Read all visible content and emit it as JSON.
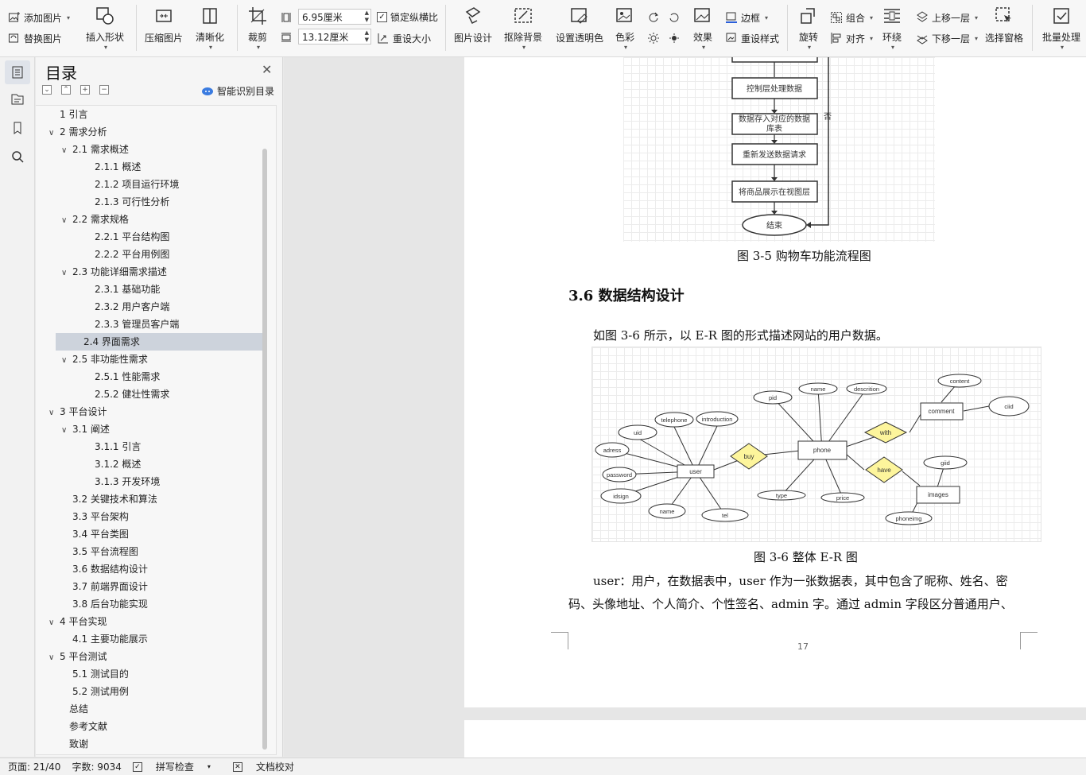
{
  "ribbon": {
    "add_picture": "添加图片",
    "replace_picture": "替换图片",
    "insert_shape": "插入形状",
    "compress": "压缩图片",
    "sharpen": "清晰化",
    "crop": "裁剪",
    "width_value": "6.95厘米",
    "height_value": "13.12厘米",
    "lock_ratio": "锁定纵横比",
    "reset_size": "重设大小",
    "picture_design": "图片设计",
    "remove_bg": "抠除背景",
    "set_transparent": "设置透明色",
    "color": "色彩",
    "effects": "效果",
    "border": "边框",
    "reset_style": "重设样式",
    "rotate": "旋转",
    "group": "组合",
    "align": "对齐",
    "wrap": "环绕",
    "bring_forward": "上移一层",
    "send_backward": "下移一层",
    "selection_pane": "选择窗格",
    "batch": "批量处理"
  },
  "toc": {
    "title": "目录",
    "smart_label": "智能识别目录",
    "items": [
      {
        "label": "1  引言",
        "level": 1,
        "arrow": ""
      },
      {
        "label": "2  需求分析",
        "level": 1,
        "arrow": "∨"
      },
      {
        "label": "2.1  需求概述",
        "level": 2,
        "arrow": "∨"
      },
      {
        "label": "2.1.1  概述",
        "level": 3,
        "arrow": ""
      },
      {
        "label": "2.1.2  项目运行环境",
        "level": 3,
        "arrow": ""
      },
      {
        "label": "2.1.3  可行性分析",
        "level": 3,
        "arrow": ""
      },
      {
        "label": "2.2  需求规格",
        "level": 2,
        "arrow": "∨"
      },
      {
        "label": "2.2.1  平台结构图",
        "level": 3,
        "arrow": ""
      },
      {
        "label": "2.2.2  平台用例图",
        "level": 3,
        "arrow": ""
      },
      {
        "label": "2.3  功能详细需求描述",
        "level": 2,
        "arrow": "∨"
      },
      {
        "label": "2.3.1  基础功能",
        "level": 3,
        "arrow": ""
      },
      {
        "label": "2.3.2  用户客户端",
        "level": 3,
        "arrow": ""
      },
      {
        "label": "2.3.3  管理员客户端",
        "level": 3,
        "arrow": ""
      },
      {
        "label": "2.4  界面需求",
        "level": 2,
        "arrow": "",
        "selected": true
      },
      {
        "label": "2.5 非功能性需求",
        "level": 2,
        "arrow": "∨"
      },
      {
        "label": "2.5.1  性能需求",
        "level": 3,
        "arrow": ""
      },
      {
        "label": "2.5.2  健壮性需求",
        "level": 3,
        "arrow": ""
      },
      {
        "label": "3  平台设计",
        "level": 1,
        "arrow": "∨"
      },
      {
        "label": "3.1  阐述",
        "level": 2,
        "arrow": "∨"
      },
      {
        "label": "3.1.1  引言",
        "level": 3,
        "arrow": ""
      },
      {
        "label": "3.1.2  概述",
        "level": 3,
        "arrow": ""
      },
      {
        "label": "3.1.3  开发环境",
        "level": 3,
        "arrow": ""
      },
      {
        "label": "3.2  关键技术和算法",
        "level": 2,
        "arrow": ""
      },
      {
        "label": "3.3  平台架构",
        "level": 2,
        "arrow": ""
      },
      {
        "label": "3.4  平台类图",
        "level": 2,
        "arrow": ""
      },
      {
        "label": "3.5  平台流程图",
        "level": 2,
        "arrow": ""
      },
      {
        "label": "3.6  数据结构设计",
        "level": 2,
        "arrow": ""
      },
      {
        "label": "3.7  前端界面设计",
        "level": 2,
        "arrow": ""
      },
      {
        "label": "3.8  后台功能实现",
        "level": 2,
        "arrow": ""
      },
      {
        "label": "4  平台实现",
        "level": 1,
        "arrow": "∨"
      },
      {
        "label": "4.1  主要功能展示",
        "level": 2,
        "arrow": ""
      },
      {
        "label": "5  平台测试",
        "level": 1,
        "arrow": "∨"
      },
      {
        "label": "5.1  测试目的",
        "level": 2,
        "arrow": ""
      },
      {
        "label": "5.2  测试用例",
        "level": 2,
        "arrow": ""
      },
      {
        "label": "总结",
        "level": 0,
        "arrow": ""
      },
      {
        "label": "参考文献",
        "level": 0,
        "arrow": ""
      },
      {
        "label": "致谢",
        "level": 0,
        "arrow": ""
      }
    ]
  },
  "doc": {
    "flow": {
      "box1": "控制层处理数据",
      "box2a": "数据存入对应的数据",
      "box2b": "库表",
      "box3": "重新发送数据请求",
      "box4": "将商品展示在视图层",
      "end": "结束",
      "no_label": "否"
    },
    "fig35_caption": "图 3-5 购物车功能流程图",
    "section_heading": "3.6  数据结构设计",
    "intro_para": "如图 3-6 所示，以 E-R 图的形式描述网站的用户数据。",
    "er": {
      "entities": {
        "user": "user",
        "phone": "phone",
        "comment": "comment",
        "images": "images"
      },
      "relations": {
        "buy": "buy",
        "with": "with",
        "have": "have"
      },
      "attrs": {
        "uid": "uid",
        "telephone": "telephone",
        "introduction": "introduction",
        "adress": "adress",
        "password": "password",
        "idsign": "idsign",
        "name_user": "name",
        "tel": "tel",
        "pid": "pid",
        "name_phone": "name",
        "descrition": "descrition",
        "type": "type",
        "price": "price",
        "content": "content",
        "ciid": "ciid",
        "giid": "giid",
        "phoneimg": "phoneimg"
      }
    },
    "fig36_caption": "图 3-6  整体 E-R 图",
    "body_line1": "user：用户，在数据表中，user 作为一张数据表，其中包含了昵称、姓名、密",
    "body_line2": "码、头像地址、个人简介、个性签名、admin 字。通过 admin 字段区分普通用户、",
    "page_number": "17"
  },
  "status": {
    "page": "页面: 21/40",
    "words": "字数: 9034",
    "spell": "拼写检查",
    "proof": "文档校对"
  }
}
